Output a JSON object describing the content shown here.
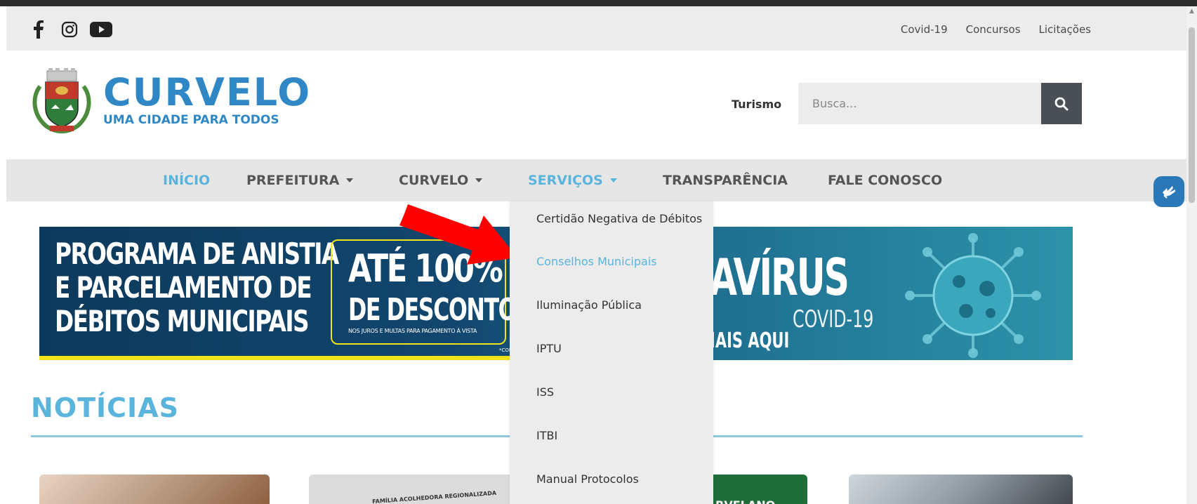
{
  "topbar": {
    "links": [
      "Covid-19",
      "Concursos",
      "Licitações"
    ]
  },
  "header": {
    "brand_title": "CURVELO",
    "brand_subtitle": "UMA CIDADE PARA TODOS",
    "turismo": "Turismo",
    "search_placeholder": "Busca..."
  },
  "nav": {
    "items": [
      {
        "label": "INÍCIO"
      },
      {
        "label": "PREFEITURA"
      },
      {
        "label": "CURVELO"
      },
      {
        "label": "SERVIÇOS"
      },
      {
        "label": "TRANSPARÊNCIA"
      },
      {
        "label": "FALE CONOSCO"
      }
    ]
  },
  "dropdown": {
    "items": [
      "Certidão Negativa de Débitos",
      "Conselhos Municipais",
      "Iluminação Pública",
      "IPTU",
      "ISS",
      "ITBI",
      "Manual Protocolos"
    ]
  },
  "banner": {
    "left_line1": "PROGRAMA DE ANISTIA",
    "left_line2": "E PARCELAMENTO DE",
    "left_line3": "DÉBITOS MUNICIPAIS",
    "percent": "ATÉ 100%",
    "discount": "DE DESCONTO",
    "asterisk": "*",
    "fine_print": "NOS JUROS E MULTAS PARA PAGAMENTO À VISTA",
    "cons": "*CONS",
    "right_title": "AVÍRUS",
    "right_covid": "COVID-19",
    "right_aqui": "IAIS AQUI"
  },
  "news": {
    "title": "NOTÍCIAS",
    "card2_text": "FAMÍLIA ACOLHEDORA REGIONALIZADA",
    "card3_text": "RVELANO"
  },
  "colors": {
    "brand_blue": "#2f87c6",
    "accent": "#5ab4dc",
    "nav_bg": "#e6e6e6",
    "search_btn": "#4a4f55",
    "arrow": "#ff0000"
  }
}
